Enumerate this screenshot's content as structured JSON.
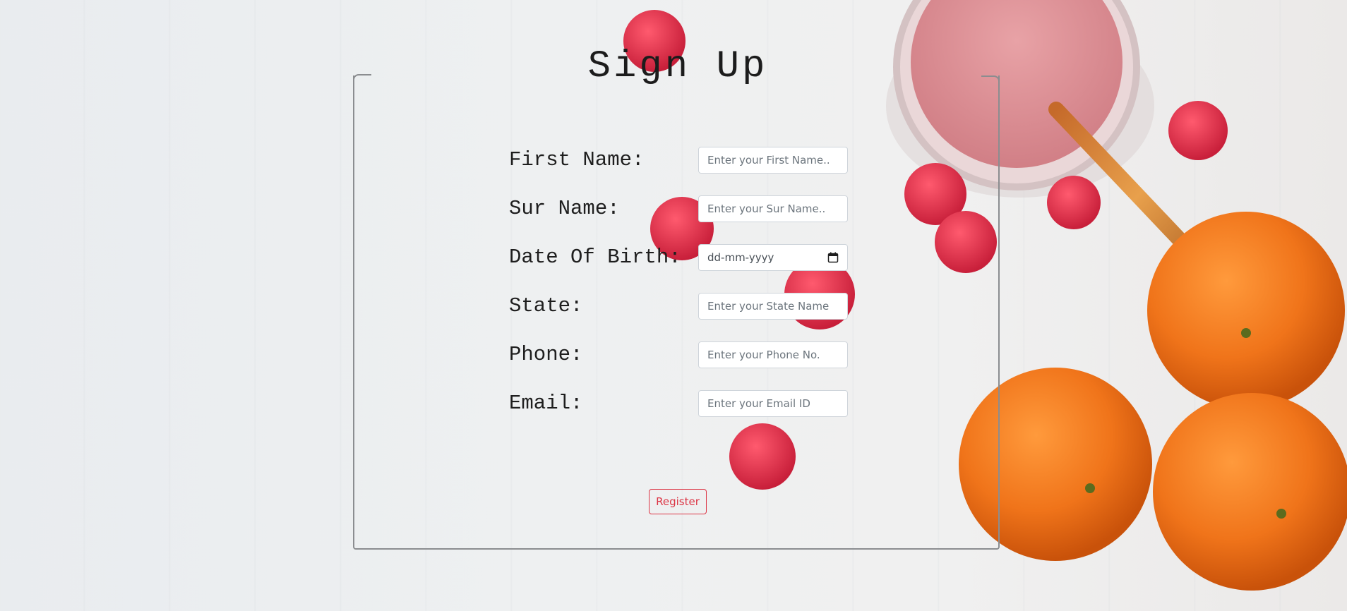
{
  "page": {
    "title": "Sign Up"
  },
  "form": {
    "fields": [
      {
        "label": "First Name:",
        "placeholder": "Enter your First Name.."
      },
      {
        "label": "Sur Name:",
        "placeholder": "Enter your Sur Name.."
      },
      {
        "label": "Date Of Birth:",
        "placeholder": "dd-mm-yyyy"
      },
      {
        "label": "State:",
        "placeholder": "Enter your State Name"
      },
      {
        "label": "Phone:",
        "placeholder": "Enter your Phone No."
      },
      {
        "label": "Email:",
        "placeholder": "Enter your Email ID"
      }
    ],
    "register_label": "Register"
  },
  "colors": {
    "accent": "#dc3545",
    "border": "#8b8d90"
  },
  "icons": {
    "date_picker": "calendar-icon"
  }
}
